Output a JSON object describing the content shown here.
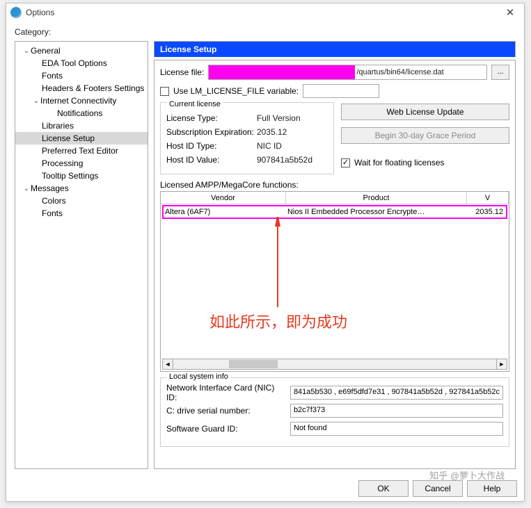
{
  "window": {
    "title": "Options",
    "close_glyph": "✕"
  },
  "category_label": "Category:",
  "tree": {
    "general": "General",
    "eda": "EDA Tool Options",
    "fonts": "Fonts",
    "headers": "Headers & Footers Settings",
    "internet": "Internet Connectivity",
    "notifications": "Notifications",
    "libraries": "Libraries",
    "license_setup": "License Setup",
    "preferred": "Preferred Text Editor",
    "processing": "Processing",
    "tooltip": "Tooltip Settings",
    "messages": "Messages",
    "colors": "Colors",
    "fonts2": "Fonts"
  },
  "panel": {
    "header": "License Setup",
    "license_file_label": "License file:",
    "license_path_suffix": "/quartus/bin64/license.dat",
    "browse_glyph": "...",
    "use_lm_label": "Use LM_LICENSE_FILE variable:",
    "current_license_title": "Current license",
    "kv": {
      "type_k": "License Type:",
      "type_v": "Full Version",
      "exp_k": "Subscription Expiration:",
      "exp_v": "2035.12",
      "hidtype_k": "Host ID Type:",
      "hidtype_v": "NIC ID",
      "hidval_k": "Host ID Value:",
      "hidval_v": "907841a5b52d"
    },
    "web_update_btn": "Web License Update",
    "grace_btn": "Begin 30-day Grace Period",
    "wait_label": "Wait for floating licenses",
    "ampp_label": "Licensed AMPP/MegaCore functions:",
    "table": {
      "col_vendor": "Vendor",
      "col_product": "Product",
      "col_version": "V",
      "row": {
        "vendor": "Altera (6AF7)",
        "product": "Nios II Embedded Processor Encrypte…",
        "version": "2035.12"
      }
    },
    "annotation": "如此所示，即为成功",
    "sysinfo": {
      "title": "Local system info",
      "nic_label": "Network Interface Card (NIC) ID:",
      "nic_value": "841a5b530 , e69f5dfd7e31 , 907841a5b52d , 927841a5b52c",
      "c_label": "C: drive serial number:",
      "c_value": "b2c7f373",
      "sg_label": "Software Guard ID:",
      "sg_value": "Not found"
    }
  },
  "buttons": {
    "ok": "OK",
    "cancel": "Cancel",
    "help": "Help"
  },
  "watermark": "知乎 @萝卜大作战"
}
